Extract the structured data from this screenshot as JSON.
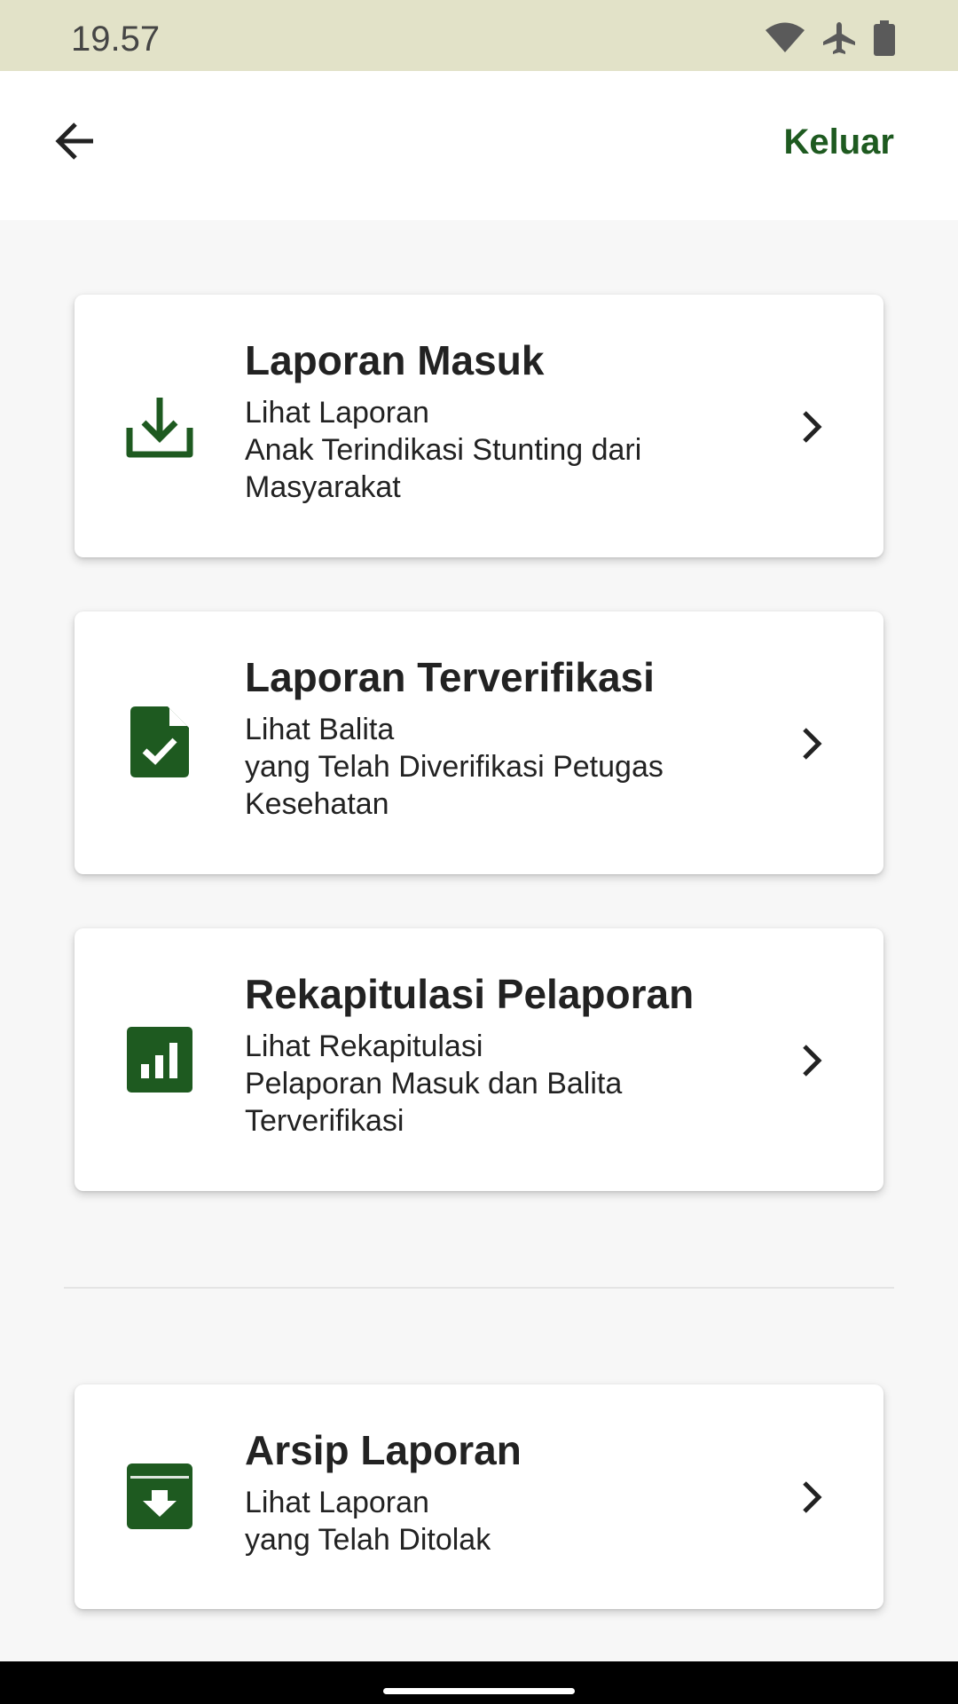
{
  "status_bar": {
    "time": "19.57",
    "icons": [
      "wifi-icon",
      "airplane-icon",
      "battery-icon"
    ]
  },
  "app_bar": {
    "back_icon": "arrow-left-icon",
    "logout_label": "Keluar"
  },
  "colors": {
    "accent": "#1e5a20",
    "status_bar_bg": "#e2e2c8",
    "page_bg": "#f7f7f7"
  },
  "menu": [
    {
      "icon": "download-icon",
      "title": "Laporan Masuk",
      "lines": [
        "Lihat Laporan",
        "Anak Terindikasi Stunting dari",
        "Masyarakat"
      ]
    },
    {
      "icon": "file-check-icon",
      "title": "Laporan Terverifikasi",
      "lines": [
        "Lihat Balita",
        "yang Telah Diverifikasi Petugas",
        "Kesehatan"
      ]
    },
    {
      "icon": "bar-chart-icon",
      "title": "Rekapitulasi Pelaporan",
      "lines": [
        "Lihat Rekapitulasi",
        "Pelaporan Masuk dan Balita",
        "Terverifikasi"
      ]
    }
  ],
  "archive": {
    "icon": "archive-icon",
    "title": "Arsip Laporan",
    "lines": [
      "Lihat Laporan",
      "yang Telah Ditolak"
    ]
  }
}
